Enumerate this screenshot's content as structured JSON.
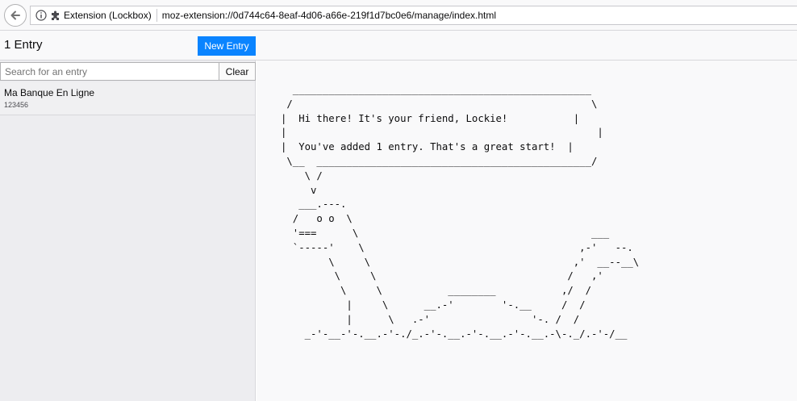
{
  "browser": {
    "extension_label": "Extension (Lockbox)",
    "url": "moz-extension://0d744c64-8eaf-4d06-a66e-219f1d7bc0e6/manage/index.html"
  },
  "header": {
    "entry_count": "1 Entry",
    "new_entry_label": "New Entry"
  },
  "search": {
    "placeholder": "Search for an entry",
    "value": "",
    "clear_label": "Clear"
  },
  "entries": [
    {
      "title": "Ma Banque En Ligne",
      "username": "123456"
    }
  ],
  "lockie": {
    "greeting": "Hi there! It's your friend, Lockie!",
    "message": "You've added 1 entry. That's a great start!"
  },
  "colors": {
    "accent": "#0a84ff",
    "sidebar_bg": "#ededf0",
    "main_bg": "#f9f9fa"
  }
}
